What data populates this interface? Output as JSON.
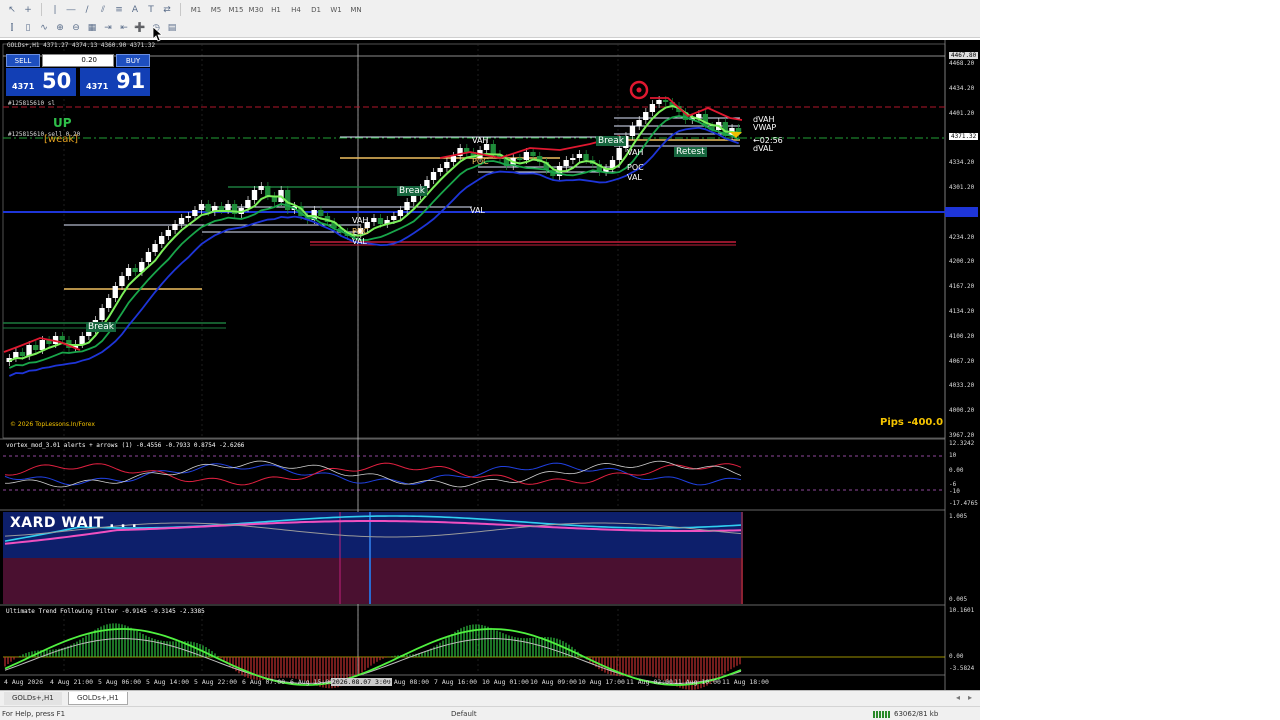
{
  "toolbar1": {
    "timeframes": [
      "M1",
      "M5",
      "M15",
      "M30",
      "H1",
      "H4",
      "D1",
      "W1",
      "MN"
    ]
  },
  "icons": {
    "cursor": "arrow-cursor-icon",
    "crosshair": "crosshair-icon",
    "zoom_in": "zoom-in-icon",
    "zoom_out": "zoom-out-icon",
    "new_order": "new-order-icon",
    "indicators": "indicators-icon"
  },
  "chart": {
    "window_title": "GOLDs+,H1  4371.27 4374.13 4360.90 4371.32",
    "trade_panel": {
      "sell_label": "SELL",
      "buy_label": "BUY",
      "lot": "0.20",
      "sell_prefix": "4371",
      "sell_big": "50",
      "buy_prefix": "4371",
      "buy_big": "91"
    },
    "order_label_1": "#125815610 sl",
    "order_label_2": "#125815610 sell 0.20",
    "trend_up": "UP",
    "trend_weak": "[weak]",
    "level_labels": {
      "vah_top": "VAH",
      "poc_mid": "POC",
      "vah_mid": "VAH",
      "poc_right": "POC",
      "val_right": "VAL",
      "val_center": "VAL",
      "vah_left": "VAH",
      "poc_left": "POC",
      "val_left": "VAL",
      "dvah": "dVAH",
      "vwap": "VWAP",
      "dval": "dVAL",
      "countdown": "←02:56"
    },
    "break_labels": [
      "Break",
      "Break",
      "Break"
    ],
    "retest_label": "Retest",
    "pips": "Pips -400.0",
    "copyright": "© 2026 TopLessons.In/Forex",
    "price_ticks": [
      "4467.80",
      "4468.20",
      "4434.20",
      "4401.20",
      "4371.32",
      "4334.20",
      "4301.20",
      "4234.20",
      "4200.20",
      "4167.20",
      "4134.20",
      "4100.20",
      "4067.20",
      "4033.20",
      "4000.20",
      "3967.20"
    ],
    "time_ticks": [
      "4 Aug 2026",
      "4 Aug 21:00",
      "5 Aug 06:00",
      "5 Aug 14:00",
      "5 Aug 22:00",
      "6 Aug 07:00",
      "6 Aug 15:00",
      "2026.08.07 3:00",
      "7 Aug 08:00",
      "7 Aug 16:00",
      "10 Aug 01:00",
      "10 Aug 09:00",
      "10 Aug 17:00",
      "11 Aug 02:00",
      "11 Aug 10:00",
      "11 Aug 18:00"
    ]
  },
  "vortex": {
    "title": "vortex_mod_3.01 alerts + arrows (1) -0.4556 -0.7933 0.8754 -2.6266",
    "ticks": [
      "12.3242",
      "10",
      "0.00",
      "-6",
      "-10",
      "-17.4765"
    ]
  },
  "xard": {
    "label": "XARD WAIT . . .",
    "ticks": [
      "1.005",
      "0.005"
    ]
  },
  "utff": {
    "title": "Ultimate Trend Following Filter -0.9145 -0.3145 -2.3385",
    "ticks": [
      "10.1601",
      "0.00",
      "-3.5824"
    ]
  },
  "tabs": [
    "GOLDs+,H1",
    "GOLDs+,H1"
  ],
  "status": {
    "help": "For Help, press F1",
    "profile": "Default",
    "traffic": "63062/81 kb"
  }
}
